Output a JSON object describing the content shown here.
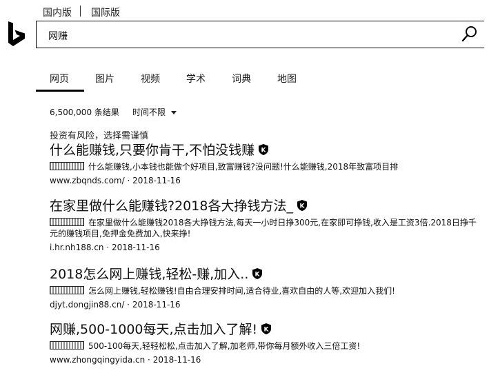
{
  "region_tabs": {
    "domestic": "国内版",
    "international": "国际版"
  },
  "search": {
    "query": "网赚"
  },
  "nav": {
    "items": [
      "网页",
      "图片",
      "视频",
      "学术",
      "词典",
      "地图"
    ]
  },
  "meta": {
    "count": "6,500,000 条结果",
    "time_filter": "时间不限"
  },
  "notice": "投资有风险，选择需谨慎",
  "results": [
    {
      "title": "什么能赚钱,只要你肯干,不怕没钱赚",
      "snippet": "什么能赚钱,小本钱也能做个好项目,致富赚钱?没问题!什么能赚钱,2018年致富项目排",
      "url": "www.zbqnds.com/",
      "date": "2018-11-16"
    },
    {
      "title": "在家里做什么能赚钱?2018各大挣钱方法_",
      "snippet": "在家里做什么能赚钱2018各大挣钱方法,每天一小时日挣300元,在家即可挣钱,收入是工资3倍.2018日挣千元的赚钱项目,免押金免费加入,快来挣!",
      "url": "i.hr.nh188.cn",
      "date": "2018-11-16"
    },
    {
      "title": "2018怎么网上赚钱,轻松-赚,加入..",
      "snippet": "怎么网上赚钱,轻松赚钱!自由合理安排时间,适合待业,喜欢自由的人等,欢迎加入我们!",
      "url": "djyt.dongjin88.cn/",
      "date": "2018-11-16"
    },
    {
      "title": "网赚,500-1000每天,点击加入了解!",
      "snippet": "500-100每天,轻轻松松,点击加入了解,加老师,带你每月额外收入三倍工资!",
      "url": "www.zhongqingyida.cn",
      "date": "2018-11-16"
    }
  ]
}
